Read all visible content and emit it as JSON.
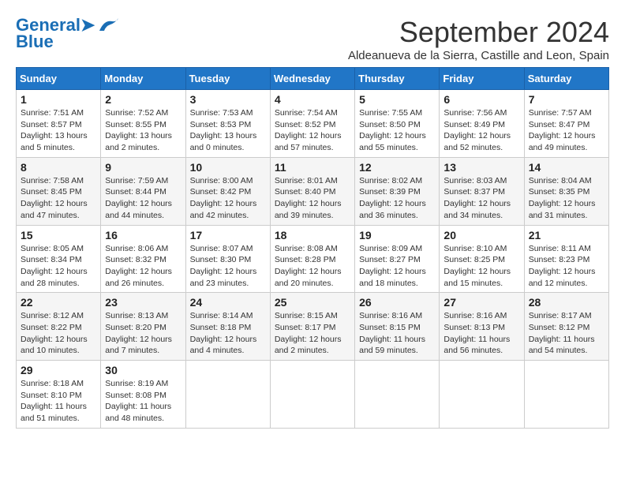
{
  "header": {
    "logo_general": "General",
    "logo_blue": "Blue",
    "month_title": "September 2024",
    "subtitle": "Aldeanueva de la Sierra, Castille and Leon, Spain"
  },
  "weekdays": [
    "Sunday",
    "Monday",
    "Tuesday",
    "Wednesday",
    "Thursday",
    "Friday",
    "Saturday"
  ],
  "weeks": [
    [
      {
        "day": "1",
        "info": "Sunrise: 7:51 AM\nSunset: 8:57 PM\nDaylight: 13 hours and 5 minutes."
      },
      {
        "day": "2",
        "info": "Sunrise: 7:52 AM\nSunset: 8:55 PM\nDaylight: 13 hours and 2 minutes."
      },
      {
        "day": "3",
        "info": "Sunrise: 7:53 AM\nSunset: 8:53 PM\nDaylight: 13 hours and 0 minutes."
      },
      {
        "day": "4",
        "info": "Sunrise: 7:54 AM\nSunset: 8:52 PM\nDaylight: 12 hours and 57 minutes."
      },
      {
        "day": "5",
        "info": "Sunrise: 7:55 AM\nSunset: 8:50 PM\nDaylight: 12 hours and 55 minutes."
      },
      {
        "day": "6",
        "info": "Sunrise: 7:56 AM\nSunset: 8:49 PM\nDaylight: 12 hours and 52 minutes."
      },
      {
        "day": "7",
        "info": "Sunrise: 7:57 AM\nSunset: 8:47 PM\nDaylight: 12 hours and 49 minutes."
      }
    ],
    [
      {
        "day": "8",
        "info": "Sunrise: 7:58 AM\nSunset: 8:45 PM\nDaylight: 12 hours and 47 minutes."
      },
      {
        "day": "9",
        "info": "Sunrise: 7:59 AM\nSunset: 8:44 PM\nDaylight: 12 hours and 44 minutes."
      },
      {
        "day": "10",
        "info": "Sunrise: 8:00 AM\nSunset: 8:42 PM\nDaylight: 12 hours and 42 minutes."
      },
      {
        "day": "11",
        "info": "Sunrise: 8:01 AM\nSunset: 8:40 PM\nDaylight: 12 hours and 39 minutes."
      },
      {
        "day": "12",
        "info": "Sunrise: 8:02 AM\nSunset: 8:39 PM\nDaylight: 12 hours and 36 minutes."
      },
      {
        "day": "13",
        "info": "Sunrise: 8:03 AM\nSunset: 8:37 PM\nDaylight: 12 hours and 34 minutes."
      },
      {
        "day": "14",
        "info": "Sunrise: 8:04 AM\nSunset: 8:35 PM\nDaylight: 12 hours and 31 minutes."
      }
    ],
    [
      {
        "day": "15",
        "info": "Sunrise: 8:05 AM\nSunset: 8:34 PM\nDaylight: 12 hours and 28 minutes."
      },
      {
        "day": "16",
        "info": "Sunrise: 8:06 AM\nSunset: 8:32 PM\nDaylight: 12 hours and 26 minutes."
      },
      {
        "day": "17",
        "info": "Sunrise: 8:07 AM\nSunset: 8:30 PM\nDaylight: 12 hours and 23 minutes."
      },
      {
        "day": "18",
        "info": "Sunrise: 8:08 AM\nSunset: 8:28 PM\nDaylight: 12 hours and 20 minutes."
      },
      {
        "day": "19",
        "info": "Sunrise: 8:09 AM\nSunset: 8:27 PM\nDaylight: 12 hours and 18 minutes."
      },
      {
        "day": "20",
        "info": "Sunrise: 8:10 AM\nSunset: 8:25 PM\nDaylight: 12 hours and 15 minutes."
      },
      {
        "day": "21",
        "info": "Sunrise: 8:11 AM\nSunset: 8:23 PM\nDaylight: 12 hours and 12 minutes."
      }
    ],
    [
      {
        "day": "22",
        "info": "Sunrise: 8:12 AM\nSunset: 8:22 PM\nDaylight: 12 hours and 10 minutes."
      },
      {
        "day": "23",
        "info": "Sunrise: 8:13 AM\nSunset: 8:20 PM\nDaylight: 12 hours and 7 minutes."
      },
      {
        "day": "24",
        "info": "Sunrise: 8:14 AM\nSunset: 8:18 PM\nDaylight: 12 hours and 4 minutes."
      },
      {
        "day": "25",
        "info": "Sunrise: 8:15 AM\nSunset: 8:17 PM\nDaylight: 12 hours and 2 minutes."
      },
      {
        "day": "26",
        "info": "Sunrise: 8:16 AM\nSunset: 8:15 PM\nDaylight: 11 hours and 59 minutes."
      },
      {
        "day": "27",
        "info": "Sunrise: 8:16 AM\nSunset: 8:13 PM\nDaylight: 11 hours and 56 minutes."
      },
      {
        "day": "28",
        "info": "Sunrise: 8:17 AM\nSunset: 8:12 PM\nDaylight: 11 hours and 54 minutes."
      }
    ],
    [
      {
        "day": "29",
        "info": "Sunrise: 8:18 AM\nSunset: 8:10 PM\nDaylight: 11 hours and 51 minutes."
      },
      {
        "day": "30",
        "info": "Sunrise: 8:19 AM\nSunset: 8:08 PM\nDaylight: 11 hours and 48 minutes."
      },
      null,
      null,
      null,
      null,
      null
    ]
  ]
}
